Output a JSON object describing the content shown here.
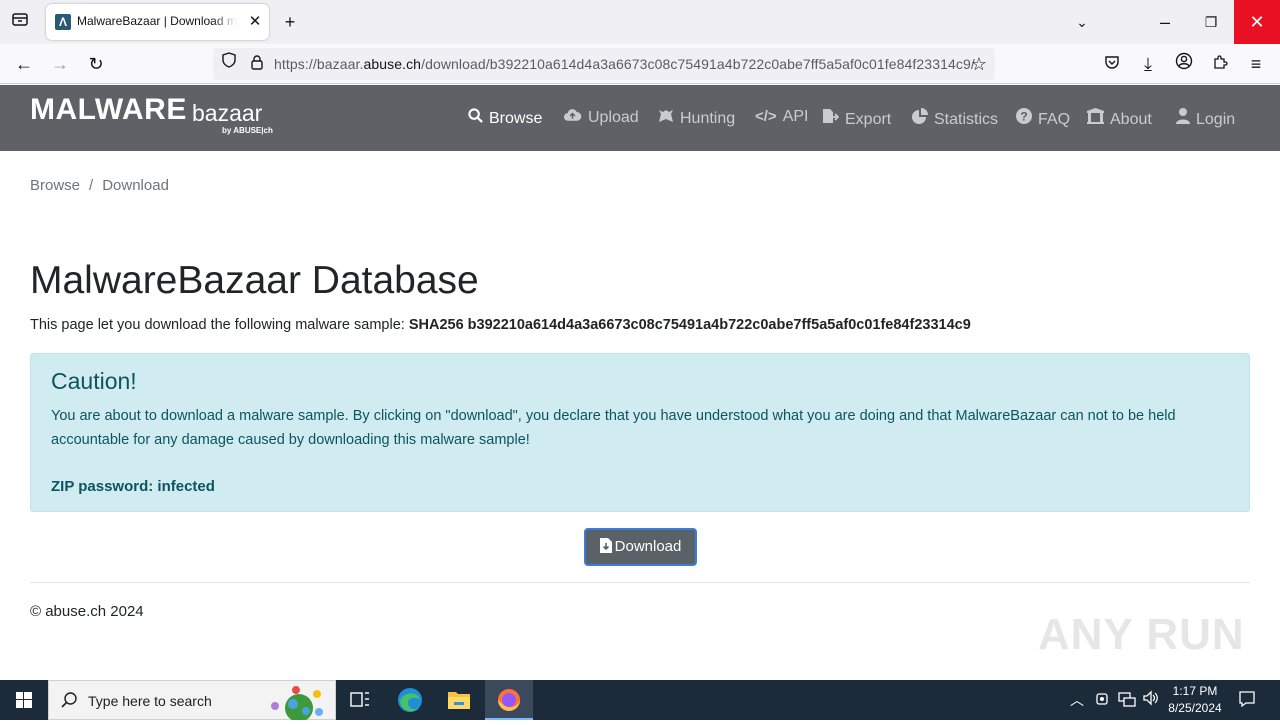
{
  "browser": {
    "tab_title": "MalwareBazaar | Download malware sample",
    "tab_favicon": "Λ",
    "url_prefix": "https://bazaar.",
    "url_domain": "abuse.ch",
    "url_path": "/download/b392210a614d4a3a6673c08c75491a4b722c0abe7ff5a5af0c01fe84f23314c9/"
  },
  "site": {
    "logo_main": "MALWARE",
    "logo_sub": "bazaar",
    "logo_abuse": "by ABUSE|ch",
    "nav": [
      {
        "label": "Browse",
        "icon": "search-icon",
        "glyph": "🔍"
      },
      {
        "label": "Upload",
        "icon": "cloud-upload-icon",
        "glyph": "☁"
      },
      {
        "label": "Hunting",
        "icon": "hunting-icon",
        "glyph": "🐺"
      },
      {
        "label": "API",
        "icon": "code-icon",
        "glyph": "</>"
      },
      {
        "label": "Export",
        "icon": "export-icon",
        "glyph": "⇥"
      },
      {
        "label": "Statistics",
        "icon": "pie-chart-icon",
        "glyph": "◔"
      },
      {
        "label": "FAQ",
        "icon": "question-icon",
        "glyph": "?"
      },
      {
        "label": "About",
        "icon": "building-icon",
        "glyph": "⌂"
      },
      {
        "label": "Login",
        "icon": "user-icon",
        "glyph": "👤"
      }
    ]
  },
  "breadcrumb": {
    "items": [
      "Browse",
      "Download"
    ],
    "separator": "/"
  },
  "page": {
    "title": "MalwareBazaar Database",
    "intro": "This page let you download the following malware sample: ",
    "sample_hash": "SHA256 b392210a614d4a3a6673c08c75491a4b722c0abe7ff5a5af0c01fe84f23314c9"
  },
  "alert": {
    "title": "Caution!",
    "body": "You are about to download a malware sample. By clicking on \"download\", you declare that you have understood what you are doing and that MalwareBazaar can not to be held accountable for any damage caused by downloading this malware sample!",
    "zip_password": "ZIP password: infected"
  },
  "download_button": "Download",
  "footer": {
    "copyright": "© abuse.ch 2024"
  },
  "watermark": "ANY RUN",
  "taskbar": {
    "search_placeholder": "Type here to search",
    "time": "1:17 PM",
    "date": "8/25/2024"
  },
  "colors": {
    "header_bg": "#5e6266",
    "alert_bg": "#d1ecf1",
    "alert_text": "#0c5460",
    "button_bg": "#5a6268",
    "taskbar_bg": "#1c2b3a"
  }
}
